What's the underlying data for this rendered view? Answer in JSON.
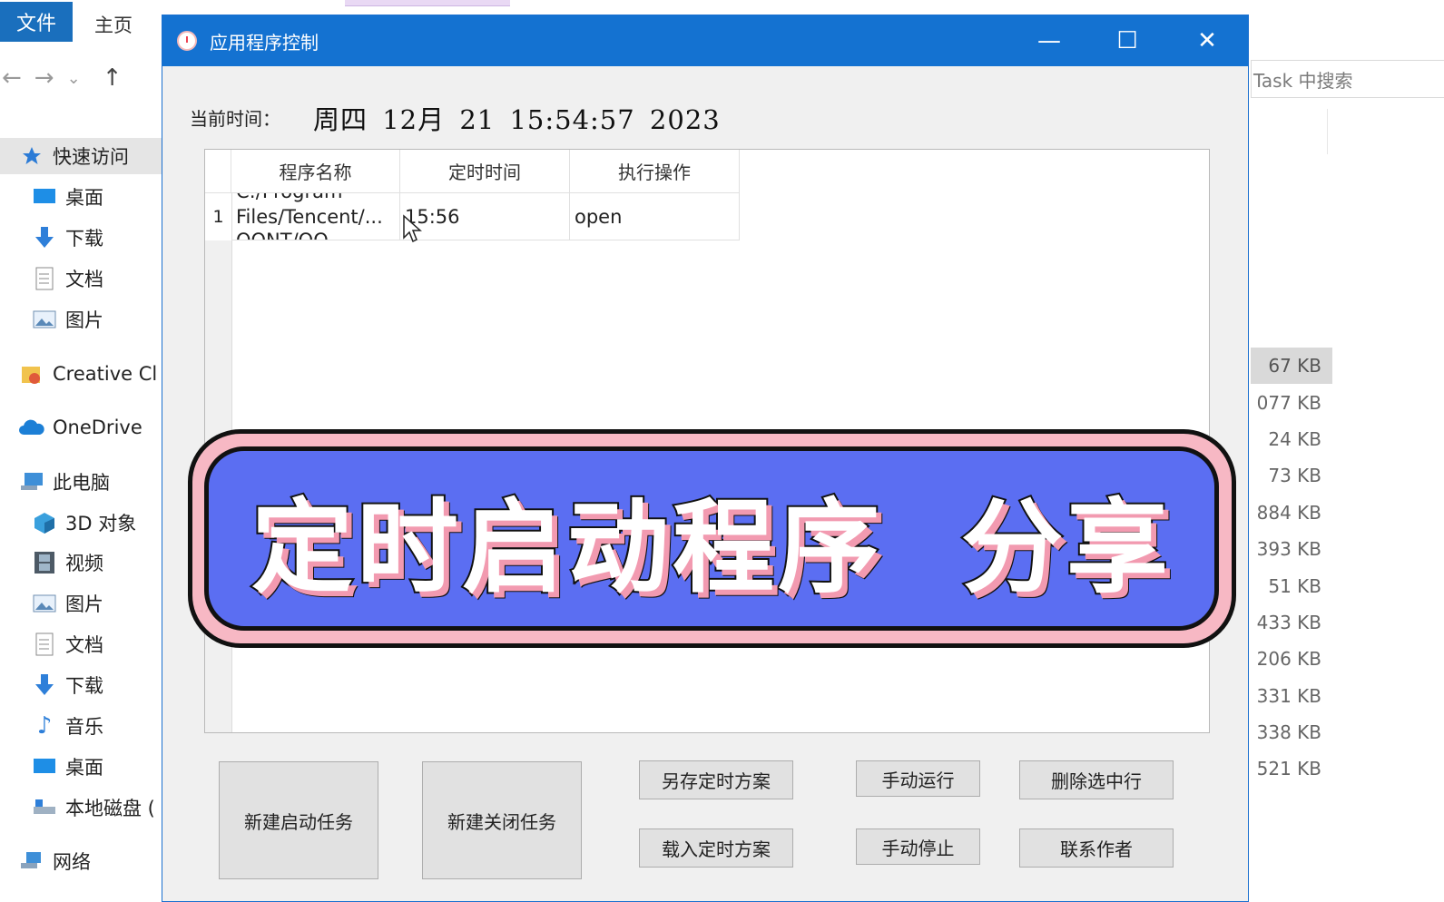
{
  "explorer": {
    "ribbon_tabs": {
      "file": "文件",
      "home": "主页"
    },
    "nav": {
      "back": "←",
      "forward": "→",
      "recent": "⌄",
      "up": "↑"
    },
    "search_placeholder": "Task 中搜索",
    "sidebar": [
      {
        "label": "快速访问",
        "icon": "star-icon"
      },
      {
        "label": "桌面",
        "icon": "desktop-icon"
      },
      {
        "label": "下载",
        "icon": "download-icon"
      },
      {
        "label": "文档",
        "icon": "document-icon"
      },
      {
        "label": "图片",
        "icon": "pictures-icon"
      },
      {
        "label": "Creative Cl",
        "icon": "creative-cloud-icon"
      },
      {
        "label": "OneDrive",
        "icon": "onedrive-icon"
      },
      {
        "label": "此电脑",
        "icon": "this-pc-icon"
      },
      {
        "label": "3D 对象",
        "icon": "3d-objects-icon"
      },
      {
        "label": "视频",
        "icon": "video-icon"
      },
      {
        "label": "图片",
        "icon": "pictures-icon"
      },
      {
        "label": "文档",
        "icon": "document-icon"
      },
      {
        "label": "下载",
        "icon": "download-icon"
      },
      {
        "label": "音乐",
        "icon": "music-icon"
      },
      {
        "label": "桌面",
        "icon": "desktop-icon"
      },
      {
        "label": "本地磁盘 (",
        "icon": "local-disk-icon"
      },
      {
        "label": "网络",
        "icon": "network-icon"
      }
    ],
    "file_sizes": [
      "67 KB",
      "077 KB",
      "24 KB",
      "73 KB",
      "884 KB",
      "393 KB",
      "51 KB",
      "433 KB",
      "206 KB",
      "331 KB",
      "338 KB",
      "521 KB"
    ]
  },
  "dialog": {
    "title": "应用程序控制",
    "controls": {
      "minimize": "—",
      "maximize": "☐",
      "close": "✕"
    },
    "time_label": "当前时间：",
    "time_value": "周四 12月 21 15:54:57 2023",
    "table": {
      "columns": [
        "程序名称",
        "定时时间",
        "执行操作"
      ],
      "rows": [
        {
          "num": "1",
          "name_top": "C:/Program",
          "name": "Files/Tencent/...",
          "name_bottom": "QQNT/QQ",
          "time": "15:56",
          "action": "open"
        }
      ]
    },
    "buttons": {
      "new_start": "新建启动任务",
      "new_close": "新建关闭任务",
      "save_plan": "另存定时方案",
      "load_plan": "载入定时方案",
      "manual_run": "手动运行",
      "manual_stop": "手动停止",
      "delete_row": "删除选中行",
      "contact": "联系作者"
    }
  },
  "overlay": {
    "title": "定时启动程序  分享"
  },
  "colors": {
    "titlebar": "#1472d1",
    "banner_fill": "#5b6ef2",
    "banner_border": "#f7b8c4",
    "banner_shadow": "#f29ab0"
  }
}
